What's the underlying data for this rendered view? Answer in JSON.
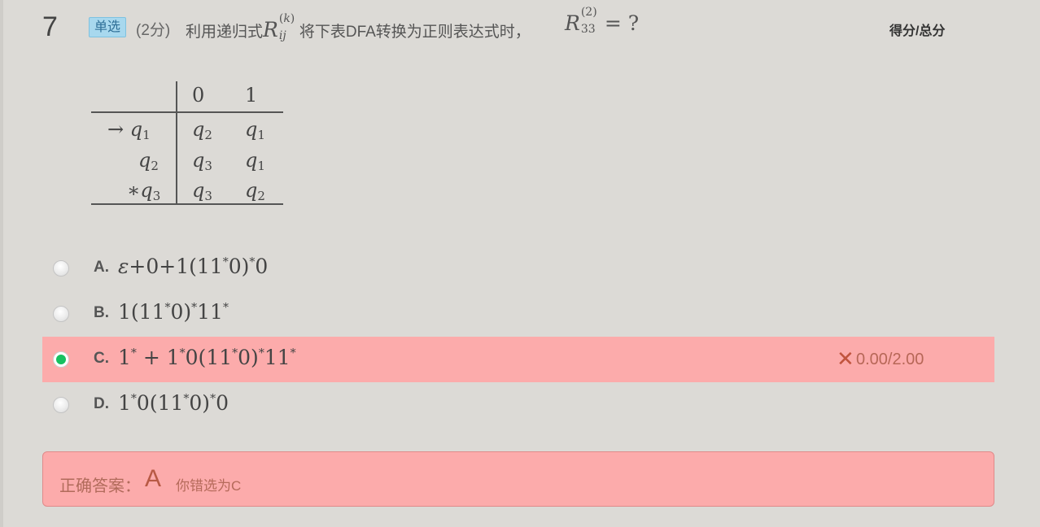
{
  "question": {
    "number": "7",
    "type_badge": "单选",
    "score": "(2分)",
    "text": "利用递归式",
    "text_after": "将下表DFA转换为正则表达式时，",
    "score_label": "得分/总分"
  },
  "dfa_table": {
    "headers": [
      "0",
      "1"
    ],
    "rows": [
      {
        "state": "→ q1",
        "on0": "q2",
        "on1": "q1"
      },
      {
        "state": "q2",
        "on0": "q3",
        "on1": "q1"
      },
      {
        "state": "*q3",
        "on0": "q3",
        "on1": "q2"
      }
    ]
  },
  "options": [
    {
      "letter": "A.",
      "text": "ε+0+1(11*0)*0",
      "selected": false
    },
    {
      "letter": "B.",
      "text": "1(11*0)*11*",
      "selected": false
    },
    {
      "letter": "C.",
      "text": "1* + 1*0(11*0)*11*",
      "selected": true,
      "result": "0.00/2.00"
    },
    {
      "letter": "D.",
      "text": "1*0(11*0)*0",
      "selected": false
    }
  ],
  "answer": {
    "label": "正确答案：",
    "correct": "A",
    "yours": "你错选为C"
  },
  "colors": {
    "background": "#dcdad6",
    "wrong_bg": "#fcabab",
    "selected_radio": "#17c160",
    "badge_bg": "#a8d8ee"
  }
}
